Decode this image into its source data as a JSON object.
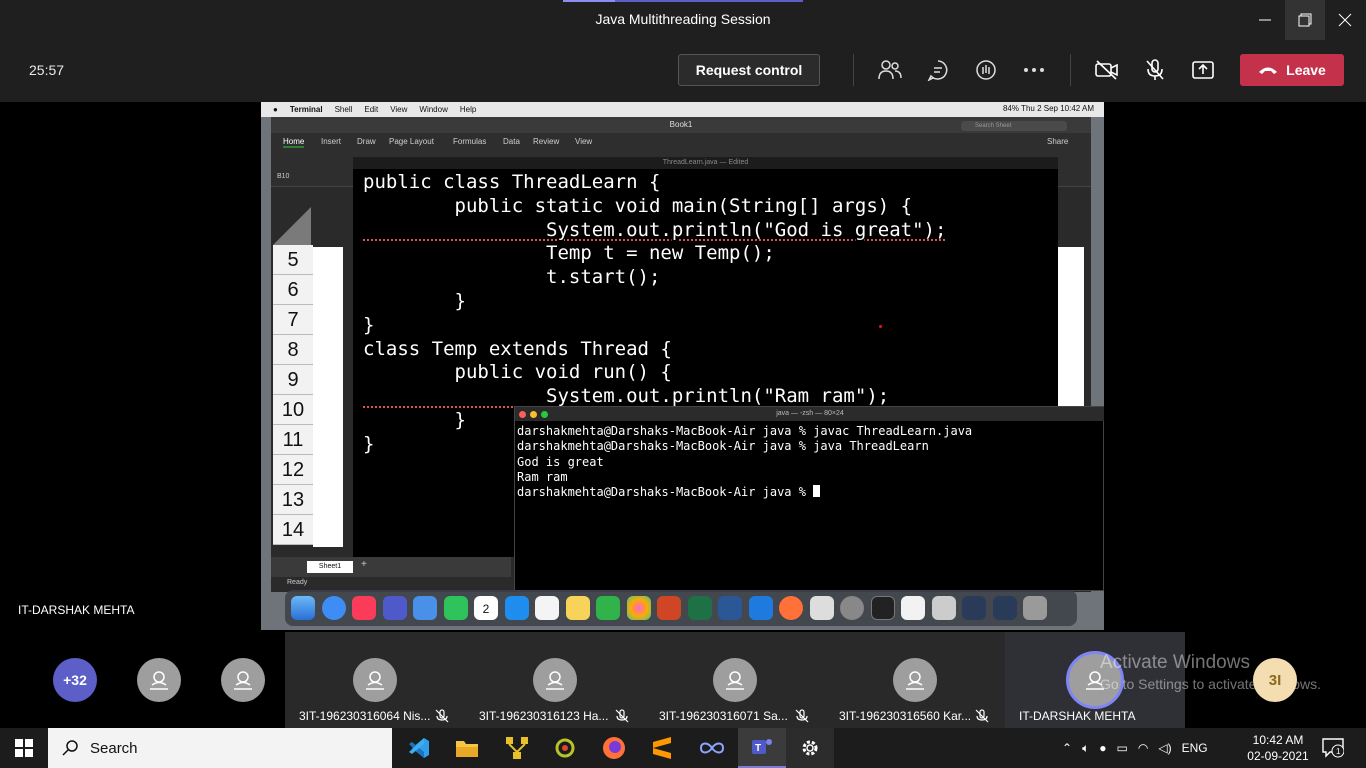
{
  "window": {
    "title": "Java Multithreading Session"
  },
  "toolbar": {
    "timer": "25:57",
    "request_control_label": "Request control",
    "leave_label": "Leave"
  },
  "stage": {
    "presenter_name": "IT-DARSHAK MEHTA"
  },
  "shared_screen": {
    "mac_menu": [
      "Terminal",
      "Shell",
      "Edit",
      "View",
      "Window",
      "Help"
    ],
    "mac_status": "84%   Thu 2 Sep  10:42 AM",
    "excel_title": "Book1",
    "excel_tabs": [
      "Home",
      "Insert",
      "Draw",
      "Page Layout",
      "Formulas",
      "Data",
      "Review",
      "View"
    ],
    "excel_share": "Share",
    "excel_search_placeholder": "Search Sheet",
    "name_box": "B10",
    "row_numbers": [
      "5",
      "6",
      "7",
      "8",
      "9",
      "10",
      "11",
      "12",
      "13",
      "14"
    ],
    "sheet_tab": "Sheet1",
    "status": "Ready",
    "editor_title": "ThreadLearn.java — Edited",
    "code_lines": [
      "public class ThreadLearn {",
      "        public static void main(String[] args) {",
      "                System.out.println(\"God is great\");",
      "                Temp t = new Temp();",
      "                t.start();",
      "        }",
      "}",
      "class Temp extends Thread {",
      "        public void run() {",
      "                System.out.println(\"Ram ram\");",
      "        }",
      "}"
    ],
    "terminal_title": "java — -zsh — 80×24",
    "terminal_lines": [
      "darshakmehta@Darshaks-MacBook-Air java % javac ThreadLearn.java",
      "darshakmehta@Darshaks-MacBook-Air java % java ThreadLearn",
      "God is great",
      "Ram ram",
      "darshakmehta@Darshaks-MacBook-Air java % "
    ],
    "dock_date": "2"
  },
  "participants": {
    "more_count": "+32",
    "tiles": [
      {
        "name": "3IT-196230316064 Nis..."
      },
      {
        "name": "3IT-196230316123 Ha..."
      },
      {
        "name": "3IT-196230316071 Sa..."
      },
      {
        "name": "3IT-196230316560 Kar..."
      },
      {
        "name": "IT-DARSHAK MEHTA"
      }
    ],
    "self_initials": "3I",
    "watermark_title": "Activate Windows",
    "watermark_sub": "Go to Settings to activate Windows."
  },
  "taskbar": {
    "search_label": "Search",
    "tray_lang": "ENG",
    "time": "10:42 AM",
    "date": "02-09-2021",
    "notif_count": "1"
  },
  "colors": {
    "leave": "#c4314b",
    "teams_accent": "#5b5fc7",
    "self_avatar_bg": "#f4ddb0",
    "self_avatar_fg": "#8a6a1f"
  }
}
